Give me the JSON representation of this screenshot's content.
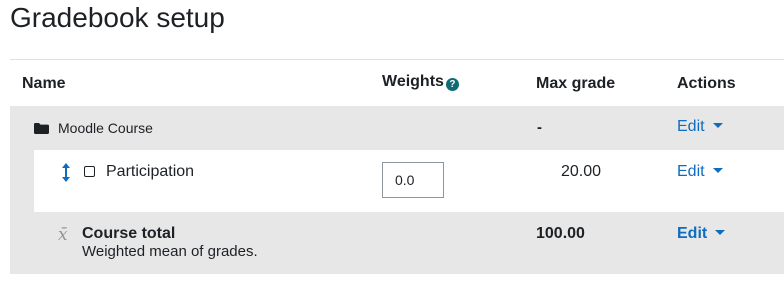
{
  "page": {
    "title": "Gradebook setup"
  },
  "table": {
    "headers": {
      "name": "Name",
      "weights": "Weights",
      "max_grade": "Max grade",
      "actions": "Actions"
    },
    "help_icon": "question-circle-icon",
    "category": {
      "icon": "folder-icon",
      "name": "Moodle Course",
      "max_grade": "-",
      "action_label": "Edit"
    },
    "item": {
      "move_icon": "move-vertical-icon",
      "type_icon": "checkbox-icon",
      "name": "Participation",
      "weight_value": "0.0",
      "max_grade": "20.00",
      "action_label": "Edit"
    },
    "total": {
      "icon": "x-bar-mean-icon",
      "icon_glyph": "x̄",
      "name": "Course total",
      "description": "Weighted mean of grades.",
      "max_grade": "100.00",
      "action_label": "Edit"
    }
  },
  "colors": {
    "link": "#0f6cbf",
    "row_background": "#e7e7e7",
    "help_icon": "#0f6c73"
  }
}
